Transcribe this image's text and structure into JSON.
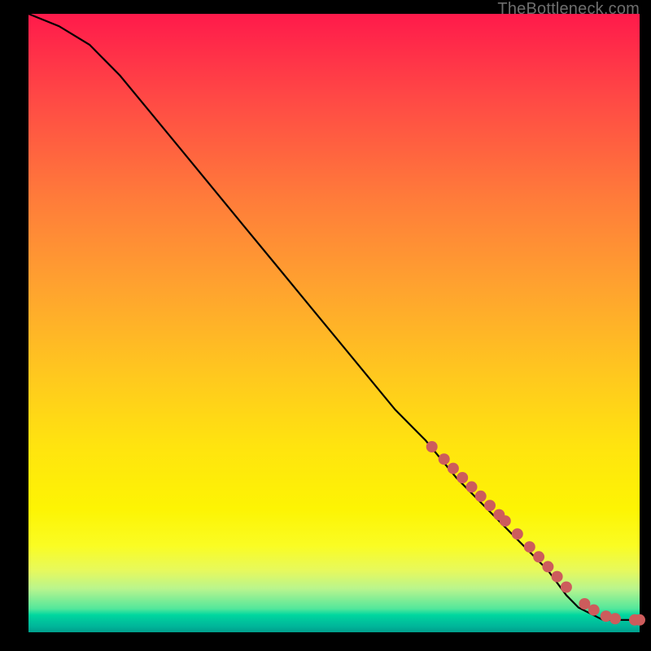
{
  "attribution": "TheBottleneck.com",
  "chart_data": {
    "type": "line",
    "title": "",
    "xlabel": "",
    "ylabel": "",
    "xlim": [
      0,
      100
    ],
    "ylim": [
      0,
      100
    ],
    "series": [
      {
        "name": "curve",
        "x": [
          0,
          5,
          10,
          15,
          20,
          25,
          30,
          35,
          40,
          45,
          50,
          55,
          60,
          65,
          70,
          75,
          80,
          85,
          88,
          90,
          92,
          94,
          96,
          98,
          100
        ],
        "y": [
          100,
          98,
          95,
          90,
          84,
          78,
          72,
          66,
          60,
          54,
          48,
          42,
          36,
          31,
          25,
          20,
          15,
          10,
          6,
          4,
          3,
          2,
          2,
          2,
          2
        ]
      },
      {
        "name": "dots",
        "x": [
          66,
          68,
          69.5,
          71,
          72.5,
          74,
          75.5,
          77,
          78,
          80,
          82,
          83.5,
          85,
          86.5,
          88,
          91,
          92.5,
          94.5,
          96,
          99.2,
          100
        ],
        "y": [
          30,
          28,
          26.5,
          25,
          23.5,
          22,
          20.5,
          19,
          18,
          15.9,
          13.8,
          12.2,
          10.6,
          9,
          7.3,
          4.6,
          3.6,
          2.6,
          2.2,
          2,
          2
        ]
      }
    ]
  }
}
